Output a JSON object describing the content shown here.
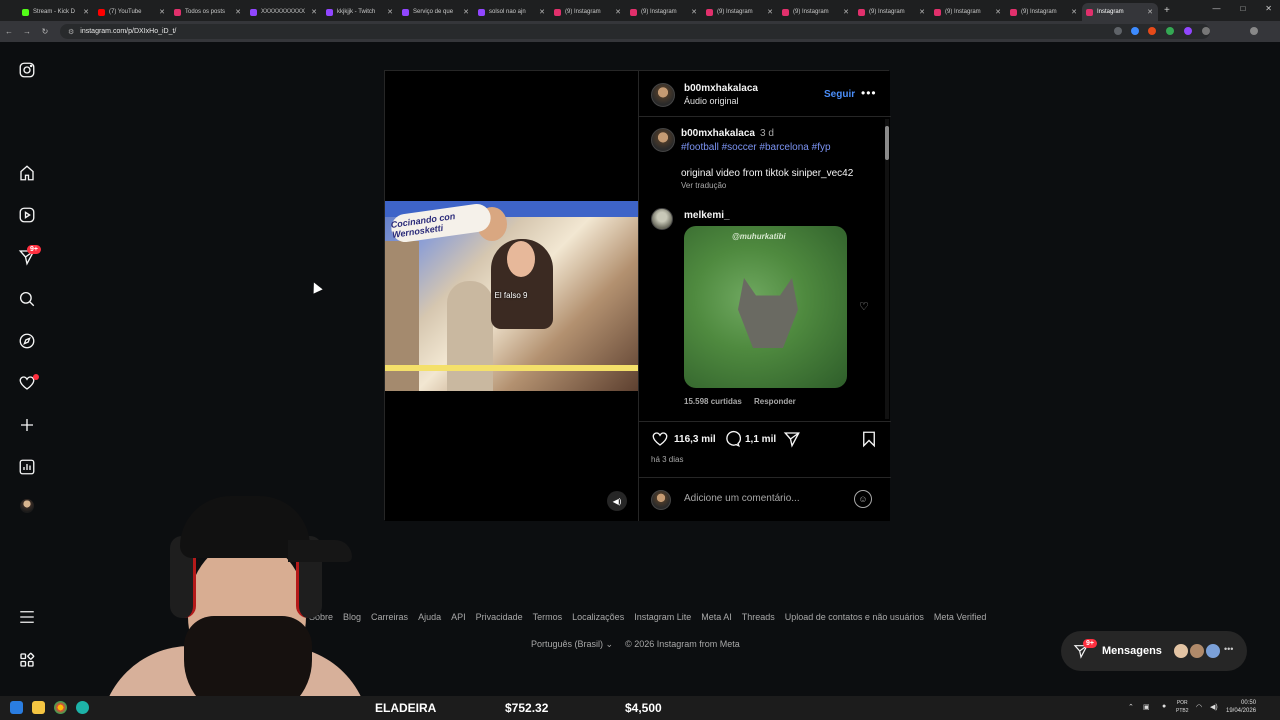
{
  "browser": {
    "tabs": [
      {
        "label": "Stream - Kick D",
        "color": "#53fc18"
      },
      {
        "label": "(7) YouTube",
        "color": "#ff0000"
      },
      {
        "label": "Todos os posts",
        "color": "#e1306c"
      },
      {
        "label": "XXXXXXXXXXX",
        "color": "#9146ff"
      },
      {
        "label": "kkjkjjk - Twitch",
        "color": "#9146ff"
      },
      {
        "label": "Serviço de que",
        "color": "#9146ff"
      },
      {
        "label": "solsol nao ajn",
        "color": "#9146ff"
      },
      {
        "label": "(9) Instagram",
        "color": "#e1306c"
      },
      {
        "label": "(9) Instagram",
        "color": "#e1306c"
      },
      {
        "label": "(9) Instagram",
        "color": "#e1306c"
      },
      {
        "label": "(9) Instagram",
        "color": "#e1306c"
      },
      {
        "label": "(9) Instagram",
        "color": "#e1306c"
      },
      {
        "label": "(9) Instagram",
        "color": "#e1306c"
      },
      {
        "label": "(9) Instagram",
        "color": "#e1306c"
      },
      {
        "label": "Instagram",
        "color": "#e1306c"
      }
    ],
    "new_tab": "+",
    "url": "instagram.com/p/DXIxHo_iD_t/"
  },
  "sidebar": {
    "notifications_badge": "9+"
  },
  "post": {
    "video_caption": "El falso 9",
    "video_sign": "Cocinando con Wernosketti",
    "header_username": "b00mxhakalaca",
    "header_audio": "Áudio original",
    "follow_label": "Seguir",
    "more_label": "•••",
    "caption_username": "b00mxhakalaca",
    "caption_time": "3 d",
    "hashtags": "#football #soccer #barcelona #fyp",
    "caption_text": "original video from tiktok siniper_vec42",
    "see_translation": "Ver tradução",
    "comment_username": "melkemi_",
    "gif_watermark": "@muhurkatibi",
    "comment_likes": "15.598 curtidas",
    "reply_label": "Responder",
    "like_count": "116,3 mil",
    "comment_count": "1,1 mil",
    "time_ago": "há 3 dias",
    "add_comment_placeholder": "Adicione um comentário..."
  },
  "footer": {
    "links": [
      "Sobre",
      "Blog",
      "Carreiras",
      "Ajuda",
      "API",
      "Privacidade",
      "Termos",
      "Localizações",
      "Instagram Lite",
      "Meta AI",
      "Threads",
      "Upload de contatos e não usuários",
      "Meta Verified"
    ],
    "language": "Português (Brasil)",
    "copyright": "© 2026 Instagram from Meta"
  },
  "messages": {
    "label": "Mensagens",
    "badge": "9+"
  },
  "taskbar": {
    "ticker_1": "ELADEIRA",
    "ticker_2": "$752.32",
    "ticker_3": "$4,500",
    "lang_line1": "POR",
    "lang_line2": "PTB2",
    "time": "00:50",
    "date": "19/04/2026"
  }
}
